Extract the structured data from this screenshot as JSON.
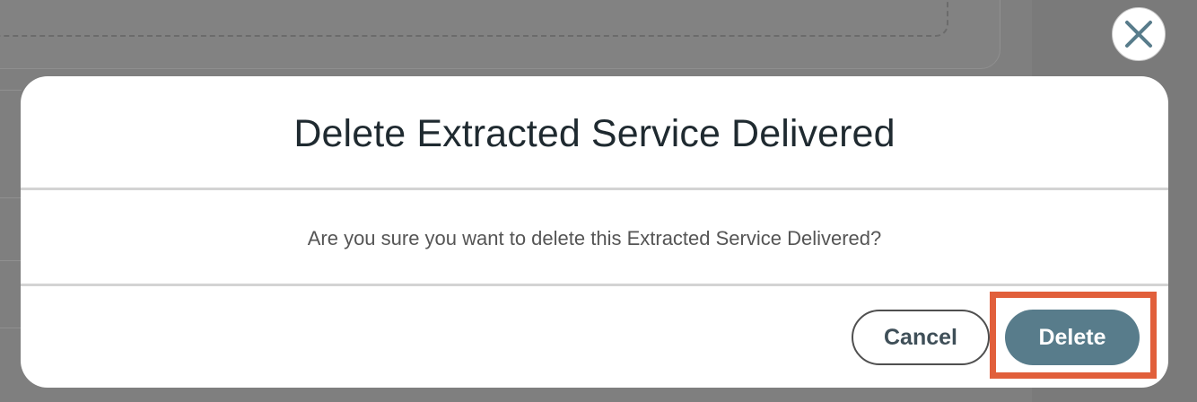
{
  "dialog": {
    "title": "Delete Extracted Service Delivered",
    "message": "Are you sure you want to delete this Extracted Service Delivered?",
    "cancel_label": "Cancel",
    "delete_label": "Delete",
    "close_icon": "close-icon"
  },
  "colors": {
    "overlay": "#7f7f7f",
    "primary_button": "#587c8b",
    "highlight_border": "#e15f3b",
    "title_text": "#1f2a30",
    "body_text": "#555555"
  }
}
